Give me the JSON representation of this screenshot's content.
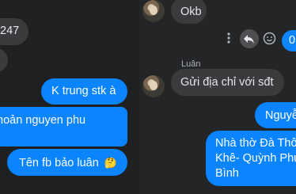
{
  "left_chat": {
    "messages": [
      {
        "text": "247",
        "side": "received"
      },
      {
        "text": "",
        "side": "received"
      },
      {
        "text": "K trung stk à",
        "side": "sent"
      },
      {
        "text": "hoản nguyen phu",
        "side": "sent"
      },
      {
        "text": "Tên fb bảo luân",
        "side": "sent",
        "emoji": "🤔"
      }
    ]
  },
  "right_chat": {
    "messages": [
      {
        "text": "Okb",
        "side": "received"
      },
      {
        "text": "0",
        "side": "sent"
      },
      {
        "sender": "Luân",
        "text": "Gửi địa chỉ với sđt",
        "side": "received"
      },
      {
        "text": "Nguyễ",
        "side": "sent"
      },
      {
        "lines": [
          "Nhà thờ Đà Thô",
          "Khê- Quỳnh Phu",
          "Bình"
        ],
        "side": "sent"
      }
    ],
    "action_icons": [
      "more-icon",
      "reply-icon",
      "emoji-icon"
    ]
  },
  "colors": {
    "sent": "#0a84ff",
    "received": "#3a3b3c",
    "background": "#242526"
  }
}
